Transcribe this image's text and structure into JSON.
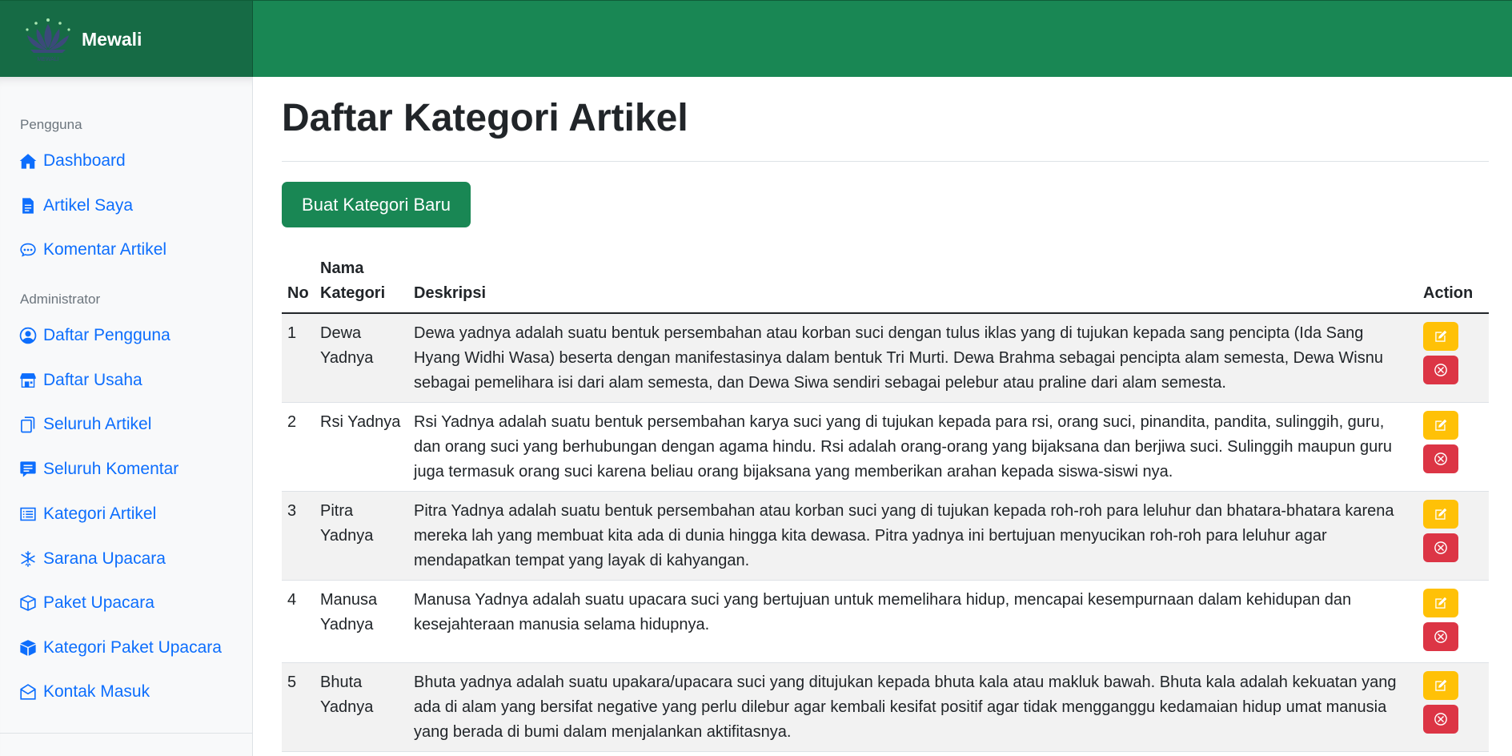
{
  "app": {
    "brand_name": "Mewali",
    "logo_text": "MEWALI",
    "colors": {
      "primary": "#198754",
      "brand_bg": "#166b45",
      "link": "#0d6efd",
      "warning": "#ffc107",
      "danger": "#dc3545"
    }
  },
  "sidebar": {
    "section_user": "Pengguna",
    "section_admin": "Administrator",
    "user_items": [
      {
        "label": "Dashboard",
        "icon": "house-icon"
      },
      {
        "label": "Artikel Saya",
        "icon": "file-text-icon"
      },
      {
        "label": "Komentar Artikel",
        "icon": "chat-dots-icon"
      }
    ],
    "admin_items": [
      {
        "label": "Daftar Pengguna",
        "icon": "person-circle-icon"
      },
      {
        "label": "Daftar Usaha",
        "icon": "shop-icon"
      },
      {
        "label": "Seluruh Artikel",
        "icon": "files-icon"
      },
      {
        "label": "Seluruh Komentar",
        "icon": "chat-square-text-icon"
      },
      {
        "label": "Kategori Artikel",
        "icon": "list-icon"
      },
      {
        "label": "Sarana Upacara",
        "icon": "snowflake-icon"
      },
      {
        "label": "Paket Upacara",
        "icon": "box-icon"
      },
      {
        "label": "Kategori Paket Upacara",
        "icon": "box-fill-icon"
      },
      {
        "label": "Kontak Masuk",
        "icon": "envelope-open-icon"
      }
    ]
  },
  "main": {
    "title": "Daftar Kategori Artikel",
    "new_button_label": "Buat Kategori Baru",
    "table": {
      "headers": {
        "no": "No",
        "name": "Nama Kategori",
        "desc": "Deskripsi",
        "action": "Action"
      },
      "rows": [
        {
          "no": "1",
          "name": "Dewa Yadnya",
          "desc": "Dewa yadnya adalah suatu bentuk persembahan atau korban suci dengan tulus iklas yang di tujukan kepada sang pencipta (Ida Sang Hyang Widhi Wasa) beserta dengan manifestasinya dalam bentuk Tri Murti. Dewa Brahma sebagai pencipta alam semesta, Dewa Wisnu sebagai pemelihara isi dari alam semesta, dan Dewa Siwa sendiri sebagai pelebur atau praline dari alam semesta."
        },
        {
          "no": "2",
          "name": "Rsi Yadnya",
          "desc": "Rsi Yadnya adalah suatu bentuk persembahan karya suci yang di tujukan kepada para rsi, orang suci, pinandita, pandita, sulinggih, guru, dan orang suci yang berhubungan dengan agama hindu. Rsi adalah orang-orang yang bijaksana dan berjiwa suci. Sulinggih maupun guru juga termasuk orang suci karena beliau orang bijaksana yang memberikan arahan kepada siswa-siswi nya."
        },
        {
          "no": "3",
          "name": "Pitra Yadnya",
          "desc": "Pitra Yadnya adalah suatu bentuk persembahan atau korban suci yang di tujukan kepada roh-roh para leluhur dan bhatara-bhatara karena mereka lah yang membuat kita ada di dunia hingga kita dewasa. Pitra yadnya ini bertujuan menyucikan roh-roh para leluhur agar mendapatkan tempat yang layak di kahyangan."
        },
        {
          "no": "4",
          "name": "Manusa Yadnya",
          "desc": "Manusa Yadnya adalah suatu upacara suci yang bertujuan untuk memelihara hidup, mencapai kesempurnaan dalam kehidupan dan kesejahteraan manusia selama hidupnya."
        },
        {
          "no": "5",
          "name": "Bhuta Yadnya",
          "desc": "Bhuta yadnya adalah suatu upakara/upacara suci yang ditujukan kepada bhuta kala atau makluk bawah. Bhuta kala adalah kekuatan yang ada di alam yang bersifat negative yang perlu dilebur agar kembali kesifat positif agar tidak mengganggu kedamaian hidup umat manusia yang berada di bumi dalam menjalankan aktifitasnya."
        }
      ]
    }
  }
}
